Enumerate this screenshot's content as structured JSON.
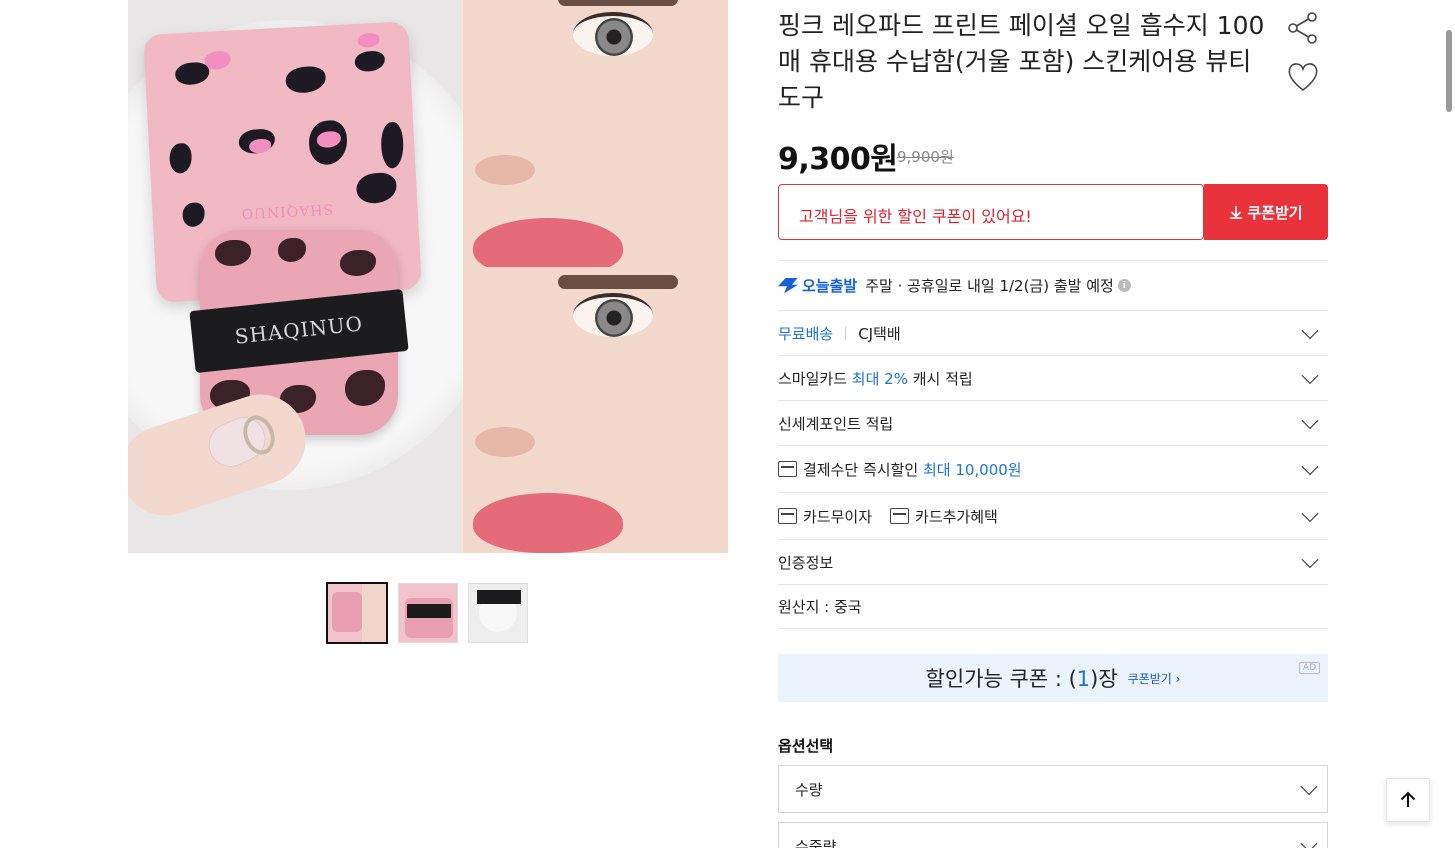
{
  "product": {
    "title": "핑크 레오파드 프린트 페이셜 오일 흡수지 100매 휴대용 수납함(거울 포함) 스킨케어용 뷰티 도구",
    "price": "9,300원",
    "original_price": "9,900원",
    "image_brand_text": "SHAQINUO"
  },
  "coupon": {
    "message": "고객님을 위한 할인 쿠폰이 있어요!",
    "button": "쿠폰받기"
  },
  "shipping": {
    "badge": "오늘출발",
    "text": "주말 · 공휴일로 내일 1/2(금) 출발 예정"
  },
  "rows": {
    "delivery_label": "무료배송",
    "delivery_courier": "CJ택배",
    "smilecard_prefix": "스마일카드",
    "smilecard_highlight": "최대 2%",
    "smilecard_suffix": "캐시 적립",
    "shinsegae": "신세계포인트 적립",
    "payment_prefix": "결제수단 즉시할인",
    "payment_highlight": "최대 10,000원",
    "card_interest_free": "카드무이자",
    "card_benefit": "카드추가혜택",
    "certification": "인증정보",
    "origin": "원산지 : 중국"
  },
  "ad_banner": {
    "text_before": "할인가능 쿠폰 : (",
    "count": "1",
    "text_after": ")장",
    "link": "쿠폰받기 ›",
    "tag": "AD"
  },
  "options": {
    "label": "옵션선택",
    "select1": "수량",
    "select2": "수중량"
  },
  "colors": {
    "accent_red": "#e8333d",
    "accent_blue": "#1a73d9",
    "banner_bg": "#ebf3fd"
  }
}
